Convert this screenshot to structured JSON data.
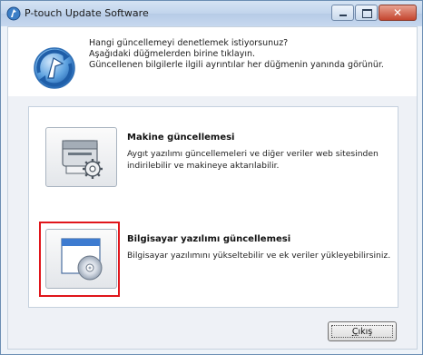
{
  "window": {
    "title": "P-touch Update Software",
    "close_glyph": "✕"
  },
  "header": {
    "line1": "Hangi güncellemeyi denetlemek istiyorsunuz?",
    "line2": "Aşağıdaki düğmelerden birine tıklayın.",
    "line3": "Güncellenen bilgilerle ilgili ayrıntılar her düğmenin yanında görünür.",
    "icon": "ptouch-update-logo-icon"
  },
  "options": [
    {
      "title": "Makine güncellemesi",
      "desc_line1": "Aygıt yazılımı güncellemeleri ve diğer veriler web sitesinden",
      "desc_line2": "indirilebilir ve makineye aktarılabilir.",
      "icon": "printer-gear-icon"
    },
    {
      "title": "Bilgisayar yazılımı güncellemesi",
      "desc_line1": "Bilgisayar yazılımını yükseltebilir ve ek veriler yükleyebilirsiniz.",
      "icon": "window-cd-icon"
    }
  ],
  "footer": {
    "exit_first": "Ç",
    "exit_rest": "ıkış"
  },
  "colors": {
    "highlight": "#e0161b",
    "titlebar": "#c1d4ec"
  }
}
